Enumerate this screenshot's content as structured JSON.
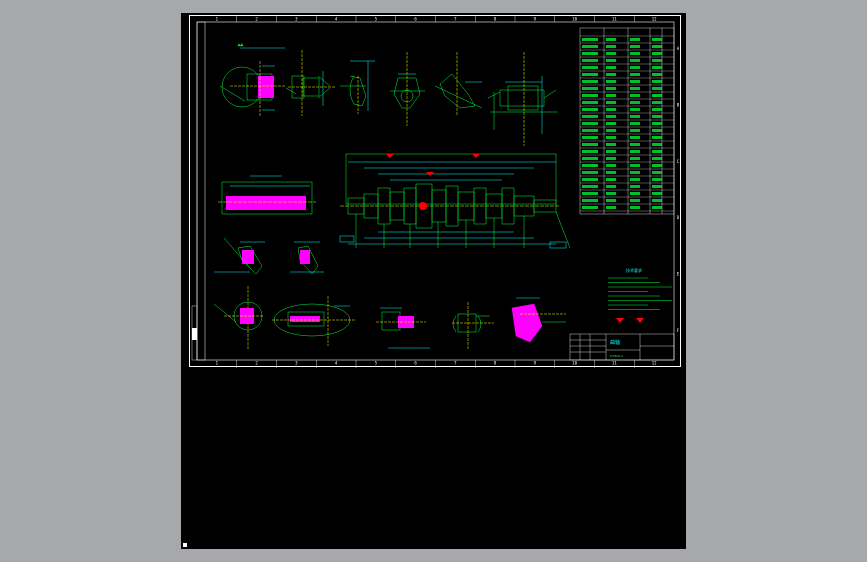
{
  "sheet": {
    "zones_top": [
      "1",
      "2",
      "3",
      "4",
      "5",
      "6",
      "7",
      "8",
      "9",
      "10",
      "11",
      "12"
    ],
    "zones_side": [
      "A",
      "B",
      "C",
      "D",
      "E",
      "F"
    ],
    "colors": {
      "background": "#000000",
      "frame": "#ffffff",
      "geometry": "#00ff3a",
      "dimension": "#00ffff",
      "section_hatch": "#ff00ff",
      "surface_mark": "#ff0000",
      "center_line": "#ffff00",
      "outer_gray": "#a7a8ab"
    },
    "title_block": {
      "part_name": "曲轴",
      "material": "QT800-2"
    },
    "tech_requirements_title": "技术要求"
  }
}
